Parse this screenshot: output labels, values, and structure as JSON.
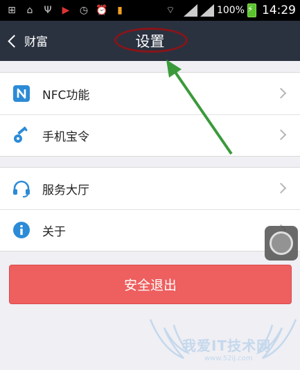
{
  "status_bar": {
    "battery_percent": "100%",
    "time": "14:29"
  },
  "nav": {
    "back_label": "财富",
    "title": "设置"
  },
  "groups": [
    {
      "items": [
        {
          "label": "NFC功能",
          "icon": "nfc-icon"
        },
        {
          "label": "手机宝令",
          "icon": "key-icon"
        }
      ]
    },
    {
      "items": [
        {
          "label": "服务大厅",
          "icon": "headset-icon"
        },
        {
          "label": "关于",
          "icon": "info-icon"
        }
      ]
    }
  ],
  "logout_label": "安全退出",
  "watermark": {
    "text": "我爱IT技术网",
    "url": "www.52ij.com"
  },
  "colors": {
    "nav_bg": "#2a3240",
    "icon_blue": "#2c8bd6",
    "logout_red": "#ee5f5f",
    "annotation_green": "#3a9a3a",
    "annotation_red": "#8a1418"
  }
}
